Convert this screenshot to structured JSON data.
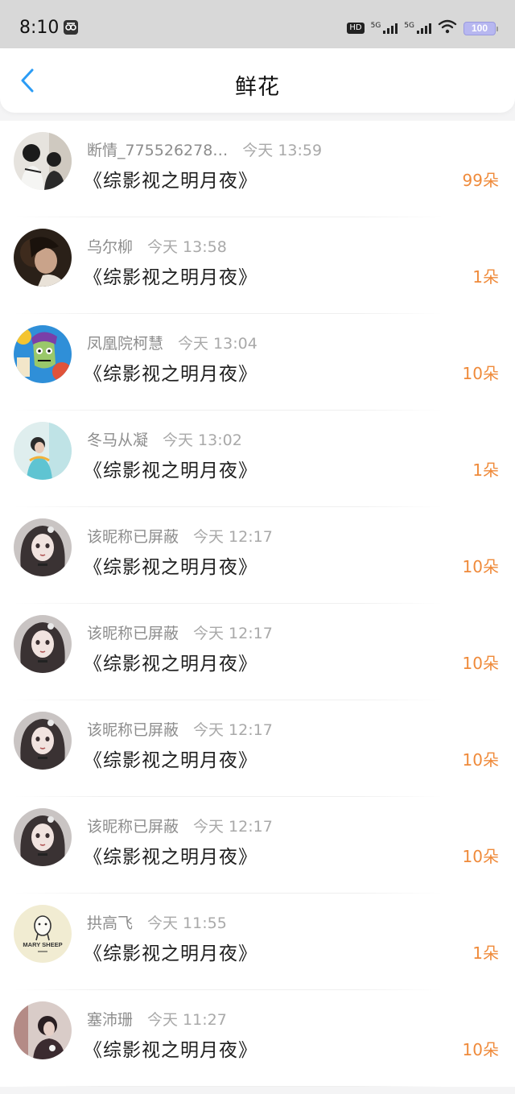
{
  "status_bar": {
    "time": "8:10",
    "hd_label": "HD",
    "network1": "5G",
    "network2": "5G",
    "battery": "100",
    "icons": [
      "app-notification-icon",
      "hd-icon",
      "signal-icon",
      "signal-icon",
      "wifi-icon",
      "battery-icon"
    ]
  },
  "nav": {
    "title": "鲜花",
    "back_icon": "chevron-left-icon"
  },
  "colors": {
    "accent_blue": "#2b9cf5",
    "amount_orange": "#ef8a3a",
    "meta_gray": "#8d8d8d"
  },
  "items": [
    {
      "name": "断情_775526278…",
      "time": "今天 13:59",
      "book": "《综影视之明月夜》",
      "amount": "99朵"
    },
    {
      "name": "乌尔柳",
      "time": "今天 13:58",
      "book": "《综影视之明月夜》",
      "amount": "1朵"
    },
    {
      "name": "凤凰院柯慧",
      "time": "今天 13:04",
      "book": "《综影视之明月夜》",
      "amount": "10朵"
    },
    {
      "name": "冬马从凝",
      "time": "今天 13:02",
      "book": "《综影视之明月夜》",
      "amount": "1朵"
    },
    {
      "name": "该昵称已屏蔽",
      "time": "今天 12:17",
      "book": "《综影视之明月夜》",
      "amount": "10朵"
    },
    {
      "name": "该昵称已屏蔽",
      "time": "今天 12:17",
      "book": "《综影视之明月夜》",
      "amount": "10朵"
    },
    {
      "name": "该昵称已屏蔽",
      "time": "今天 12:17",
      "book": "《综影视之明月夜》",
      "amount": "10朵"
    },
    {
      "name": "该昵称已屏蔽",
      "time": "今天 12:17",
      "book": "《综影视之明月夜》",
      "amount": "10朵"
    },
    {
      "name": "拱高飞",
      "time": "今天 11:55",
      "book": "《综影视之明月夜》",
      "amount": "1朵"
    },
    {
      "name": "塞沛珊",
      "time": "今天 11:27",
      "book": "《综影视之明月夜》",
      "amount": "10朵"
    }
  ],
  "avatar_text": {
    "mary_sheep": "MARY SHEEP"
  }
}
